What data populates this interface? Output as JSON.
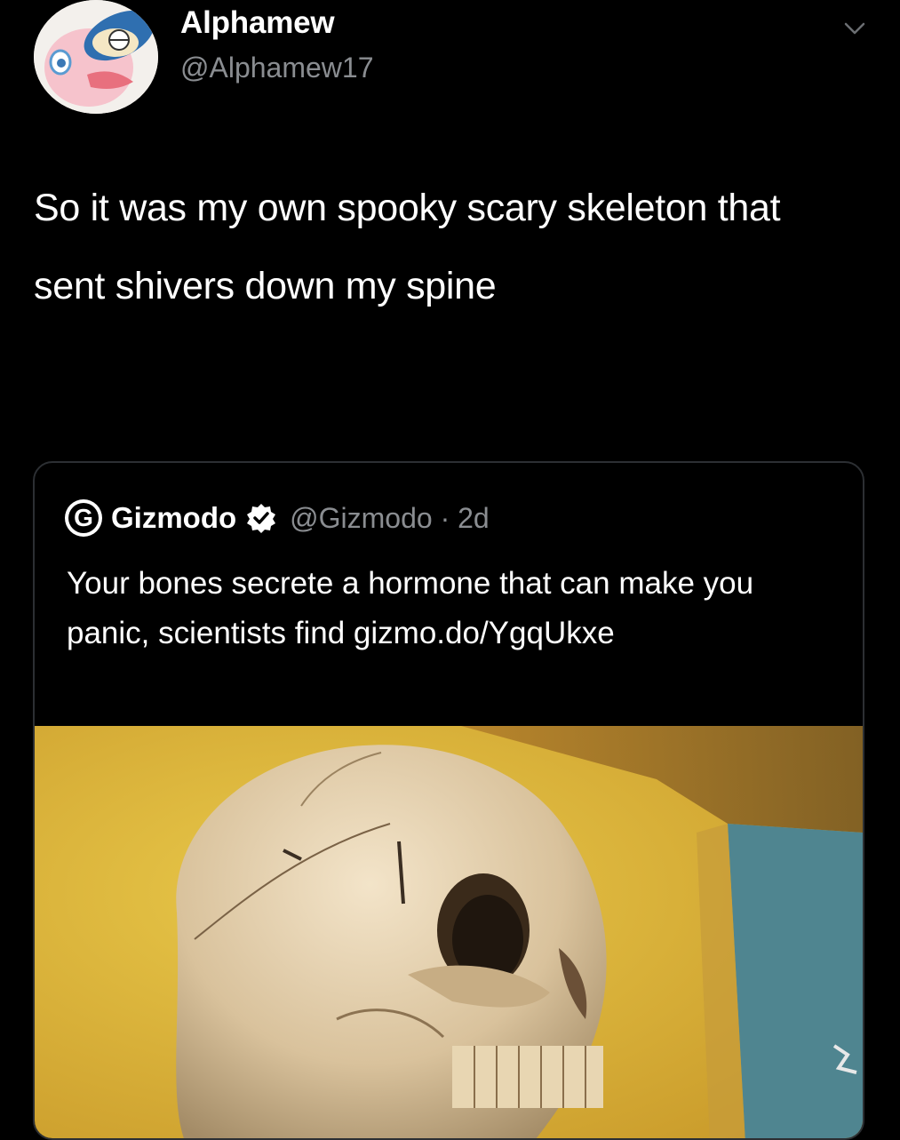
{
  "tweet": {
    "author": {
      "display_name": "Alphamew",
      "handle": "@Alphamew17",
      "avatar_icon": "pokemon-avatar-icon"
    },
    "menu_icon": "chevron-down-icon",
    "text": "So it was my own spooky scary skeleton that sent shivers down my spine"
  },
  "quoted_tweet": {
    "logo_letter": "G",
    "display_name": "Gizmodo",
    "verified_icon": "verified-badge-icon",
    "handle_and_time": "@Gizmodo · 2d",
    "text": "Your bones secrete a hormone that can make you panic, scientists find gizmo.do/YgqUkxe",
    "media_icon": "skull-photo"
  },
  "colors": {
    "background": "#000000",
    "text_primary": "#ffffff",
    "text_secondary": "#8a8d91",
    "card_border": "#2c2f33",
    "verified_badge": "#ffffff"
  }
}
